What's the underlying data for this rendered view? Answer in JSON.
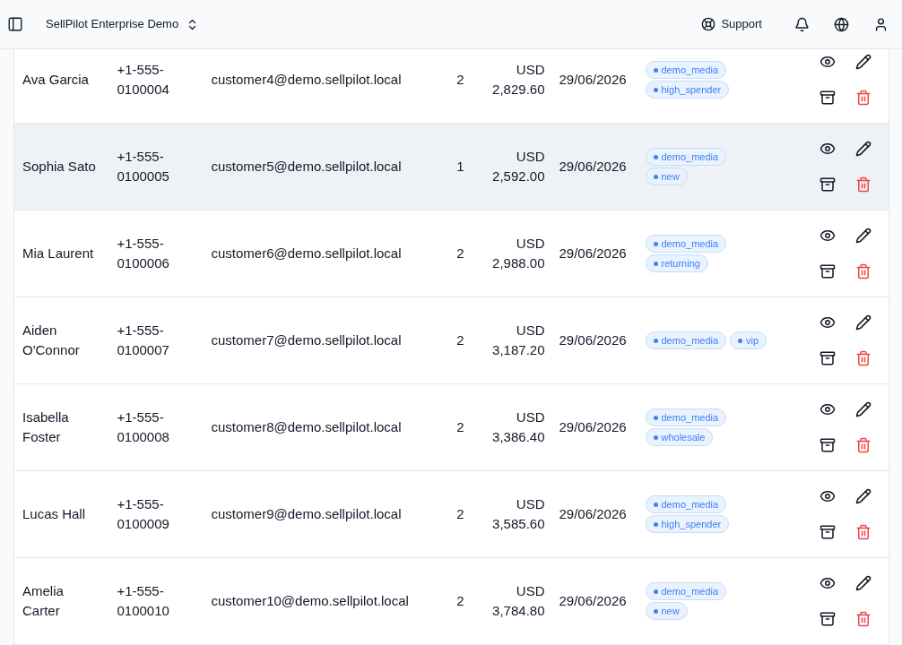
{
  "top_bar": {
    "workspace": "SellPilot Enterprise Demo",
    "support": "Support"
  },
  "table": {
    "rows": [
      {
        "name": "Ava Garcia",
        "phone": "+1-555-0100004",
        "email": "customer4@demo.sellpilot.local",
        "count": "2",
        "amount": "USD 2,829.60",
        "date": "29/06/2026",
        "tags": [
          "demo_media",
          "high_spender"
        ],
        "hovered": false
      },
      {
        "name": "Sophia Sato",
        "phone": "+1-555-0100005",
        "email": "customer5@demo.sellpilot.local",
        "count": "1",
        "amount": "USD 2,592.00",
        "date": "29/06/2026",
        "tags": [
          "demo_media",
          "new"
        ],
        "hovered": true
      },
      {
        "name": "Mia Laurent",
        "phone": "+1-555-0100006",
        "email": "customer6@demo.sellpilot.local",
        "count": "2",
        "amount": "USD 2,988.00",
        "date": "29/06/2026",
        "tags": [
          "demo_media",
          "returning"
        ],
        "hovered": false
      },
      {
        "name": "Aiden O'Connor",
        "phone": "+1-555-0100007",
        "email": "customer7@demo.sellpilot.local",
        "count": "2",
        "amount": "USD 3,187.20",
        "date": "29/06/2026",
        "tags": [
          "demo_media",
          "vip"
        ],
        "hovered": false
      },
      {
        "name": "Isabella Foster",
        "phone": "+1-555-0100008",
        "email": "customer8@demo.sellpilot.local",
        "count": "2",
        "amount": "USD 3,386.40",
        "date": "29/06/2026",
        "tags": [
          "demo_media",
          "wholesale"
        ],
        "hovered": false
      },
      {
        "name": "Lucas Hall",
        "phone": "+1-555-0100009",
        "email": "customer9@demo.sellpilot.local",
        "count": "2",
        "amount": "USD 3,585.60",
        "date": "29/06/2026",
        "tags": [
          "demo_media",
          "high_spender"
        ],
        "hovered": false
      },
      {
        "name": "Amelia Carter",
        "phone": "+1-555-0100010",
        "email": "customer10@demo.sellpilot.local",
        "count": "2",
        "amount": "USD 3,784.80",
        "date": "29/06/2026",
        "tags": [
          "demo_media",
          "new"
        ],
        "hovered": false
      }
    ]
  }
}
